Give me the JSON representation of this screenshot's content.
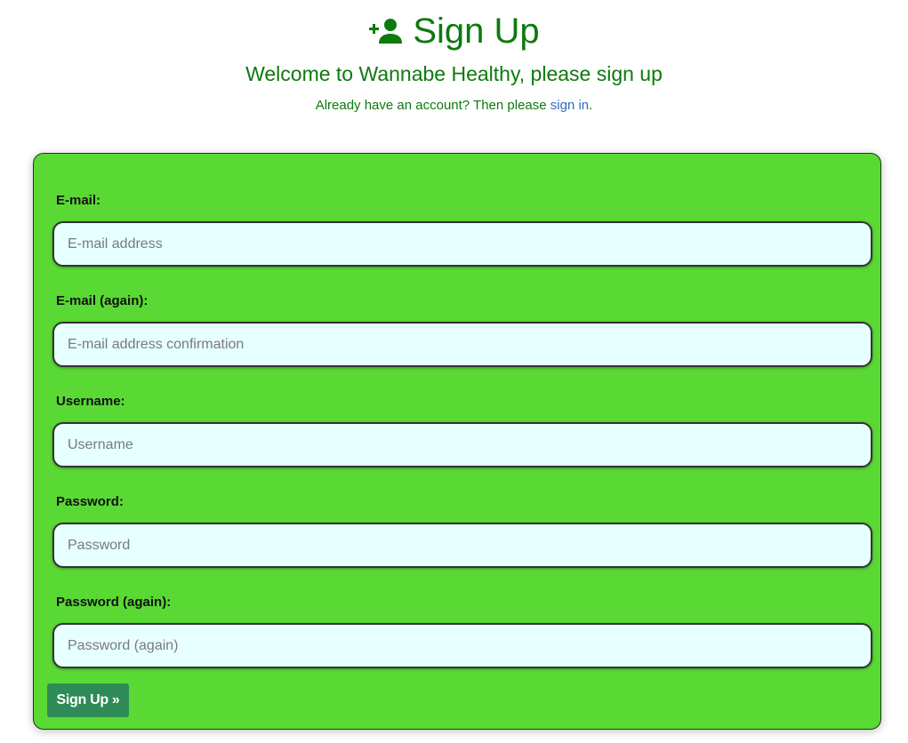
{
  "header": {
    "title": "Sign Up",
    "icon": "user-plus-icon",
    "subtitle": "Welcome to Wannabe Healthy, please sign up",
    "signin_prefix": "Already have an account? Then please",
    "signin_link": "sign in",
    "signin_suffix": "."
  },
  "form": {
    "fields": [
      {
        "label": "E-mail:",
        "placeholder": "E-mail address"
      },
      {
        "label": "E-mail (again):",
        "placeholder": "E-mail address confirmation"
      },
      {
        "label": "Username:",
        "placeholder": "Username"
      },
      {
        "label": "Password:",
        "placeholder": "Password"
      },
      {
        "label": "Password (again):",
        "placeholder": "Password (again)"
      }
    ],
    "submit_label": "Sign Up »"
  },
  "colors": {
    "title_green": "#0d7a0d",
    "card_green": "#5ad935",
    "input_bg": "#e6ffff",
    "button_bg": "#2e8b57",
    "link_blue": "#2f6bc1"
  }
}
